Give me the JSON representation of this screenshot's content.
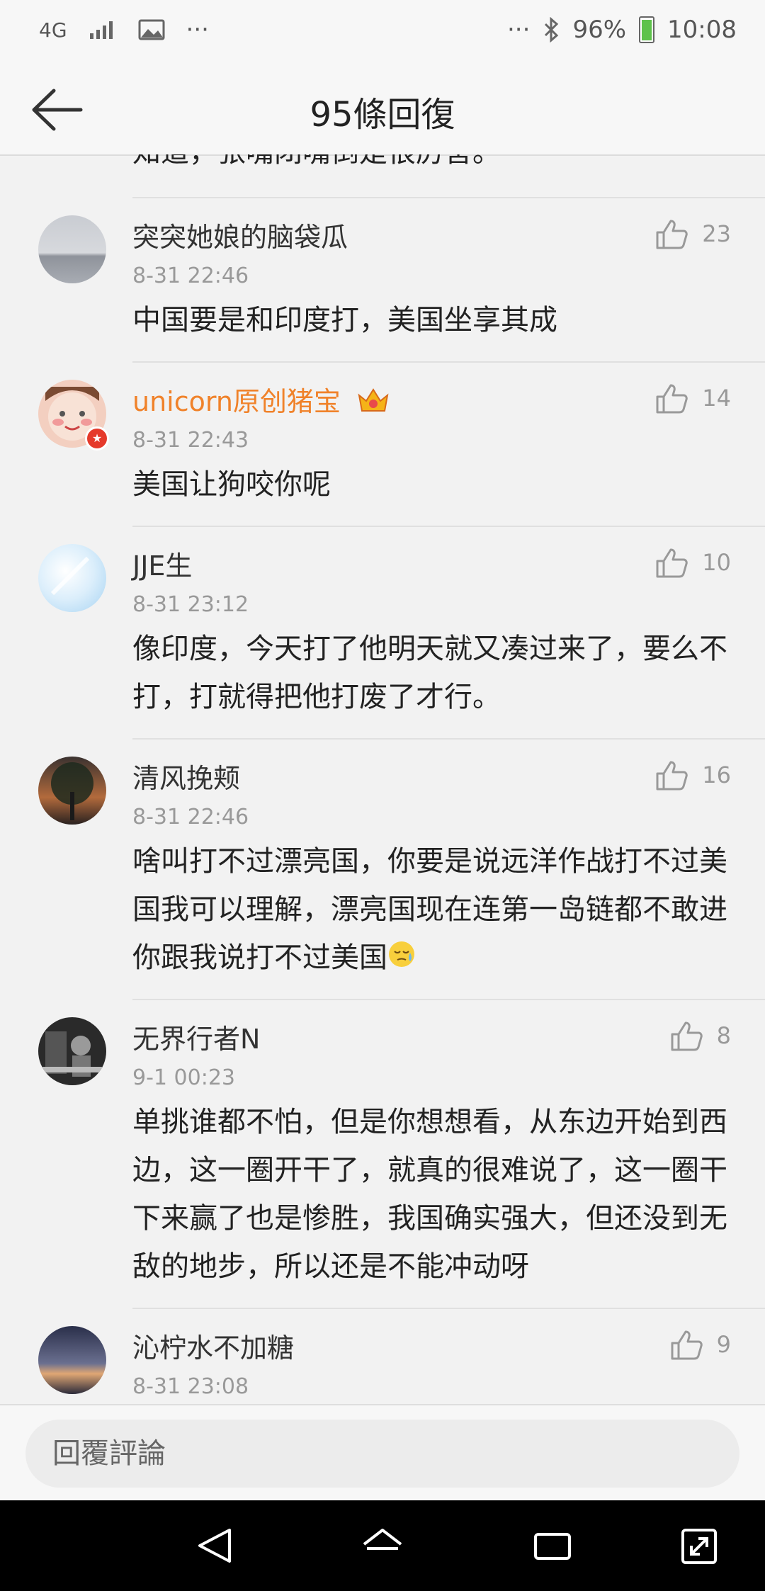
{
  "status_bar": {
    "network": "4G",
    "battery_pct": "96%",
    "time": "10:08",
    "dots": "···"
  },
  "header": {
    "title": "95條回復"
  },
  "partial_comment": {
    "text": "知道，张嘴闭嘴倒是很厉害。"
  },
  "comments": [
    {
      "username": "突突她娘的脑袋瓜",
      "time": "8-31 22:46",
      "likes": "23",
      "text": "中国要是和印度打，美国坐享其成"
    },
    {
      "username": "unicorn原创猪宝",
      "time": "8-31 22:43",
      "likes": "14",
      "text": "美国让狗咬你呢"
    },
    {
      "username": "JJE生",
      "time": "8-31 23:12",
      "likes": "10",
      "text": "像印度，今天打了他明天就又凑过来了，要么不打，打就得把他打废了才行。"
    },
    {
      "username": "清风挽颊",
      "time": "8-31 22:46",
      "likes": "16",
      "text": "啥叫打不过漂亮国，你要是说远洋作战打不过美国我可以理解，漂亮国现在连第一岛链都不敢进你跟我说打不过美国"
    },
    {
      "username": "无界行者N",
      "time": "9-1 00:23",
      "likes": "8",
      "text": "单挑谁都不怕，但是你想想看，从东边开始到西边，这一圈开干了，就真的很难说了，这一圈干下来赢了也是惨胜，我国确实强大，但还没到无敌的地步，所以还是不能冲动呀"
    },
    {
      "username": "沁柠水不加糖",
      "time": "8-31 23:08",
      "likes": "9",
      "text": ""
    }
  ],
  "reply_bar": {
    "placeholder": "回覆評論"
  }
}
